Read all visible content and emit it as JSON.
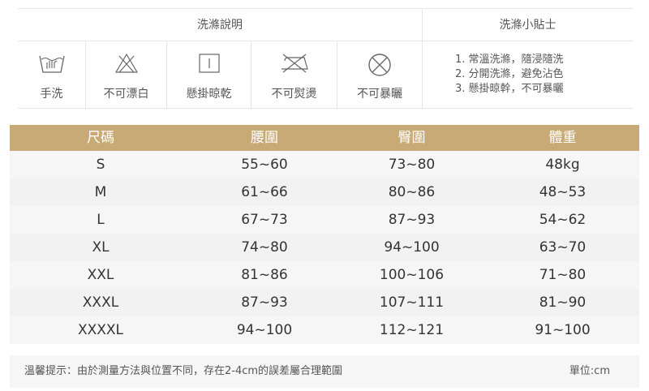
{
  "care": {
    "left_title": "洗滌說明",
    "right_title": "洗滌小貼士",
    "items": [
      {
        "label": "手洗",
        "icon": "hand-wash-icon"
      },
      {
        "label": "不可漂白",
        "icon": "no-bleach-icon"
      },
      {
        "label": "懸掛晾乾",
        "icon": "hang-dry-icon"
      },
      {
        "label": "不可熨燙",
        "icon": "no-iron-icon"
      },
      {
        "label": "不可暴曬",
        "icon": "no-sun-icon"
      }
    ],
    "tips": [
      "1. 常溫洗滌，隨浸隨洗",
      "2. 分開洗滌，避免沾色",
      "3. 懸掛晾幹，不可暴曬"
    ]
  },
  "size_table": {
    "headers": [
      "尺碼",
      "腰圍",
      "臀圍",
      "體重"
    ],
    "rows": [
      [
        "S",
        "55~60",
        "73~80",
        "48kg"
      ],
      [
        "M",
        "61~66",
        "80~86",
        "48~53"
      ],
      [
        "L",
        "67~73",
        "87~93",
        "54~62"
      ],
      [
        "XL",
        "74~80",
        "94~100",
        "63~70"
      ],
      [
        "XXL",
        "81~86",
        "100~106",
        "71~80"
      ],
      [
        "XXXL",
        "87~93",
        "107~111",
        "81~90"
      ],
      [
        "XXXXL",
        "94~100",
        "112~121",
        "91~100"
      ]
    ],
    "header_color": "#c8aa77"
  },
  "footer": {
    "note": "溫馨提示：由於測量方法與位置不同，存在2-4cm的誤差屬合理範圍",
    "unit": "單位:cm"
  }
}
